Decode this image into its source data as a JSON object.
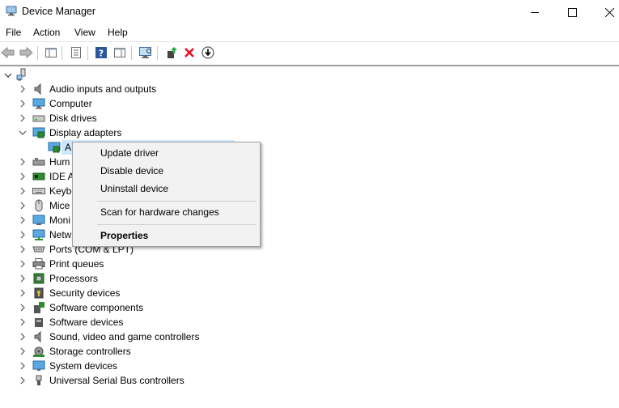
{
  "window": {
    "title": "Device Manager",
    "minimize": "—",
    "maximize": "☐",
    "close": "✕"
  },
  "menu": [
    "File",
    "Action",
    "View",
    "Help"
  ],
  "toolbar": {
    "icons": [
      "back-icon",
      "forward-icon",
      "show-hide-console-tree-icon",
      "properties-icon",
      "help-icon",
      "action-pane-icon",
      "scan-hardware-icon",
      "update-driver-icon",
      "uninstall-icon",
      "disable-icon"
    ],
    "accent_colors": {
      "help_blue": "#2b579a",
      "uninstall_red": "#e81123",
      "update_green": "#28a745"
    }
  },
  "tree": {
    "root_label": "",
    "categories": [
      {
        "label": "Audio inputs and outputs",
        "icon": "speaker-icon",
        "expanded": false
      },
      {
        "label": "Computer",
        "icon": "computer-icon",
        "expanded": false
      },
      {
        "label": "Disk drives",
        "icon": "disk-drive-icon",
        "expanded": false
      },
      {
        "label": "Display adapters",
        "icon": "display-adapter-icon",
        "expanded": true
      },
      {
        "label": "Hum",
        "icon": "hid-icon",
        "expanded": false
      },
      {
        "label": "IDE A",
        "icon": "ide-controller-icon",
        "expanded": false
      },
      {
        "label": "Keybo",
        "icon": "keyboard-icon",
        "expanded": false
      },
      {
        "label": "Mice",
        "icon": "mouse-icon",
        "expanded": false
      },
      {
        "label": "Moni",
        "icon": "monitor-icon",
        "expanded": false
      },
      {
        "label": "Netw",
        "icon": "network-icon",
        "expanded": false
      },
      {
        "label": "Ports (COM & LPT)",
        "icon": "port-icon",
        "expanded": false
      },
      {
        "label": "Print queues",
        "icon": "printer-icon",
        "expanded": false
      },
      {
        "label": "Processors",
        "icon": "processor-icon",
        "expanded": false
      },
      {
        "label": "Security devices",
        "icon": "security-device-icon",
        "expanded": false
      },
      {
        "label": "Software components",
        "icon": "software-component-icon",
        "expanded": false
      },
      {
        "label": "Software devices",
        "icon": "software-device-icon",
        "expanded": false
      },
      {
        "label": "Sound, video and game controllers",
        "icon": "speaker-icon",
        "expanded": false
      },
      {
        "label": "Storage controllers",
        "icon": "storage-controller-icon",
        "expanded": false
      },
      {
        "label": "System devices",
        "icon": "system-device-icon",
        "expanded": false
      },
      {
        "label": "Universal Serial Bus controllers",
        "icon": "usb-icon",
        "expanded": false
      }
    ],
    "child_display_adapter": "A"
  },
  "context_menu": {
    "items": [
      "Update driver",
      "Disable device",
      "Uninstall device",
      "Scan for hardware changes",
      "Properties"
    ]
  }
}
